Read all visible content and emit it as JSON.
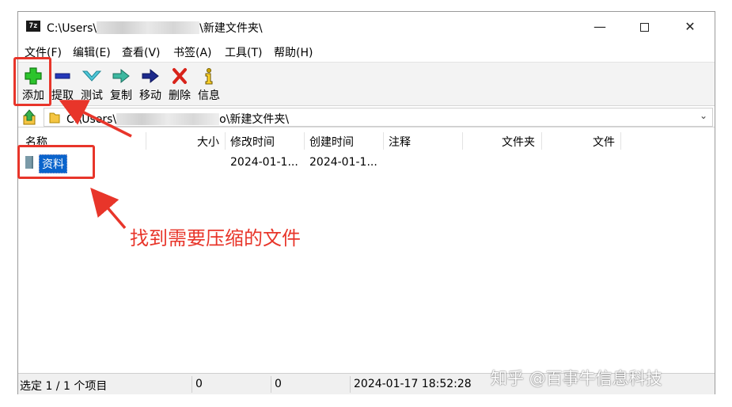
{
  "window": {
    "title_prefix": "C:\\Users\\",
    "title_suffix": "\\新建文件夹\\",
    "app_icon": "7z"
  },
  "controls": {
    "minimize": "—",
    "close": "✕"
  },
  "menu": [
    {
      "label": "文件(F)"
    },
    {
      "label": "编辑(E)"
    },
    {
      "label": "查看(V)"
    },
    {
      "label": "书签(A)"
    },
    {
      "label": "工具(T)"
    },
    {
      "label": "帮助(H)"
    }
  ],
  "toolbar": [
    {
      "label": "添加",
      "icon": "add-icon"
    },
    {
      "label": "提取",
      "icon": "extract-icon"
    },
    {
      "label": "测试",
      "icon": "test-icon"
    },
    {
      "label": "复制",
      "icon": "copy-icon"
    },
    {
      "label": "移动",
      "icon": "move-icon"
    },
    {
      "label": "删除",
      "icon": "delete-icon"
    },
    {
      "label": "信息",
      "icon": "info-icon"
    }
  ],
  "address": {
    "prefix": "C:\\Users\\",
    "suffix": "o\\新建文件夹\\",
    "dropdown": "⌄"
  },
  "columns": [
    "名称",
    "大小",
    "修改时间",
    "创建时间",
    "注释",
    "文件夹",
    "文件"
  ],
  "rows": [
    {
      "name": "资料",
      "size": "",
      "modified": "2024-01-1...",
      "created": "2024-01-1...",
      "comment": "",
      "folders": "",
      "files": ""
    }
  ],
  "status": {
    "selection": "选定 1 / 1 个项目",
    "size1": "0",
    "size2": "0",
    "datetime": "2024-01-17 18:52:28"
  },
  "annotation": {
    "text": "找到需要压缩的文件",
    "color": "#e8352a"
  },
  "watermark": "知乎 @百事牛信息科技",
  "colors": {
    "selection": "#0a64cc",
    "annotation": "#e8352a"
  }
}
